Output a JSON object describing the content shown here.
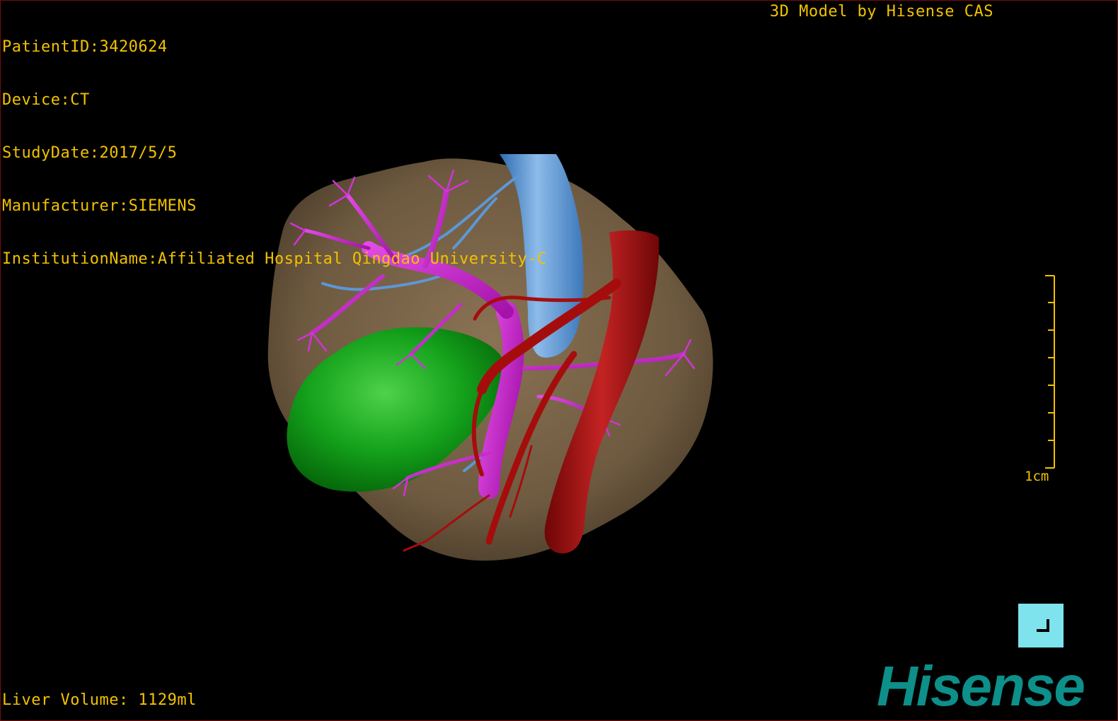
{
  "header": {
    "patient_id": "PatientID:3420624",
    "device": "Device:CT",
    "study_date": "StudyDate:2017/5/5",
    "manufacturer": "Manufacturer:SIEMENS",
    "institution": "InstitutionName:Affiliated Hospital Qingdao University-C",
    "brand": "3D Model by Hisense CAS"
  },
  "footer": {
    "liver_volume": "Liver Volume: 1129ml"
  },
  "scale_bar": {
    "label": "1cm"
  },
  "logo": {
    "text": "Hisense"
  },
  "colors": {
    "overlay_text": "#f2c200",
    "liver": "#7a6448",
    "gallbladder": "#0f9a1a",
    "portal_vein": "#c21fc7",
    "vena_cava": "#5d97d6",
    "artery": "#a50d0d",
    "corner_button": "#7ee3ec",
    "logo": "#0d8f8a"
  },
  "icons": {
    "corner_button": "corner-bracket-icon"
  }
}
